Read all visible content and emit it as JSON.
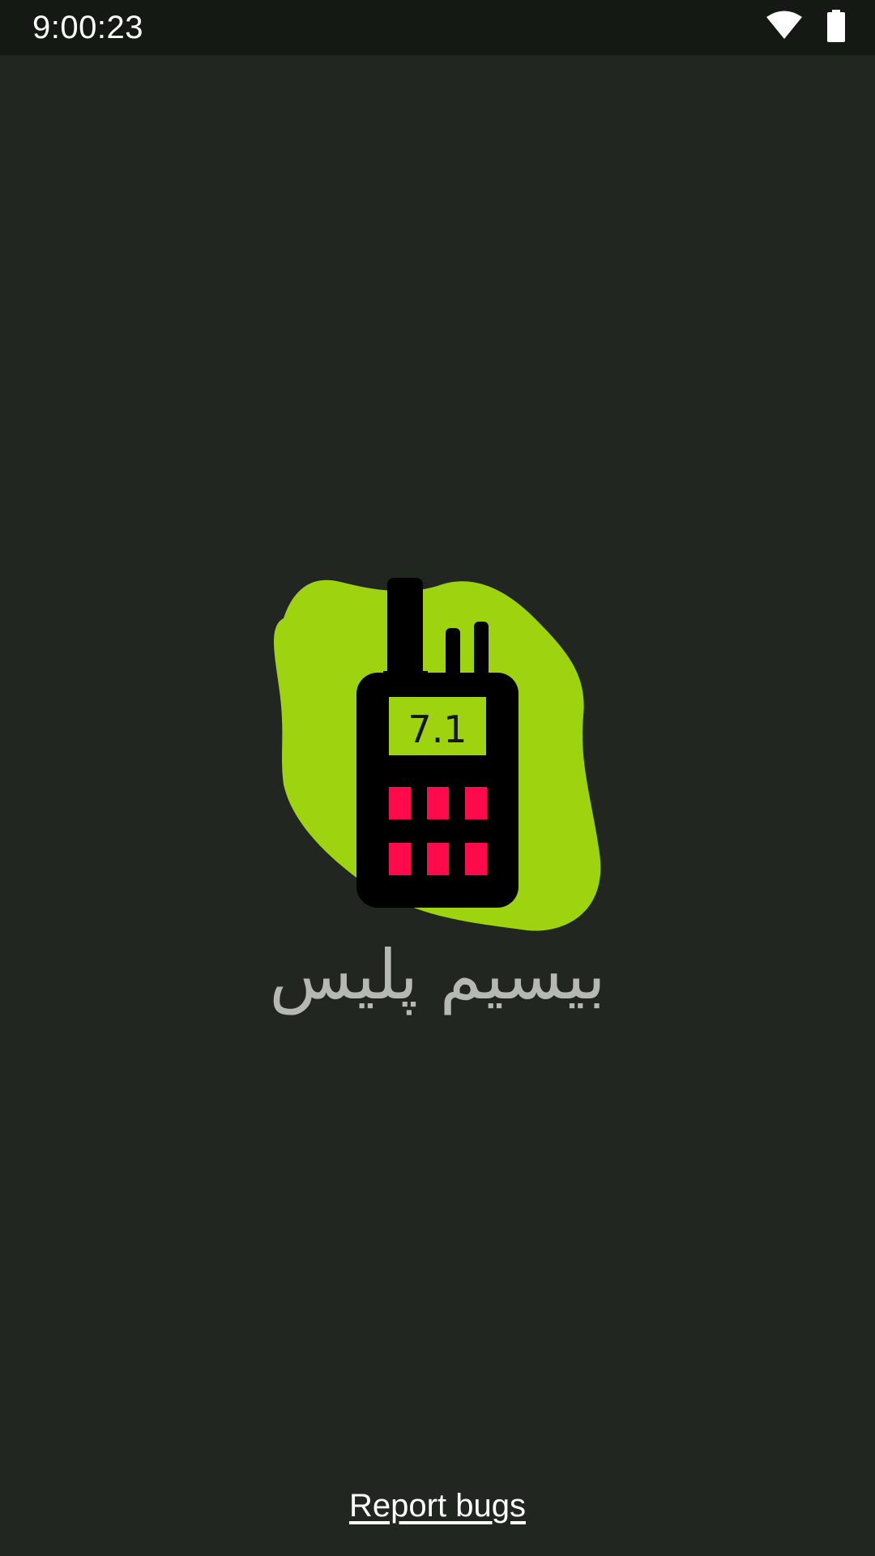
{
  "status_bar": {
    "time": "9:00:23",
    "icons": [
      "wifi-icon",
      "battery-icon"
    ]
  },
  "splash": {
    "logo_icon": "walkie-talkie-icon",
    "radio_display": "7.1",
    "title": "بیسیم پلیس",
    "colors": {
      "background": "#212720",
      "blob": "#9ed40f",
      "radio_body": "#000000",
      "keys": "#ff0a4a",
      "title_text": "#b6b8b4"
    }
  },
  "footer": {
    "report_label": "Report bugs"
  }
}
